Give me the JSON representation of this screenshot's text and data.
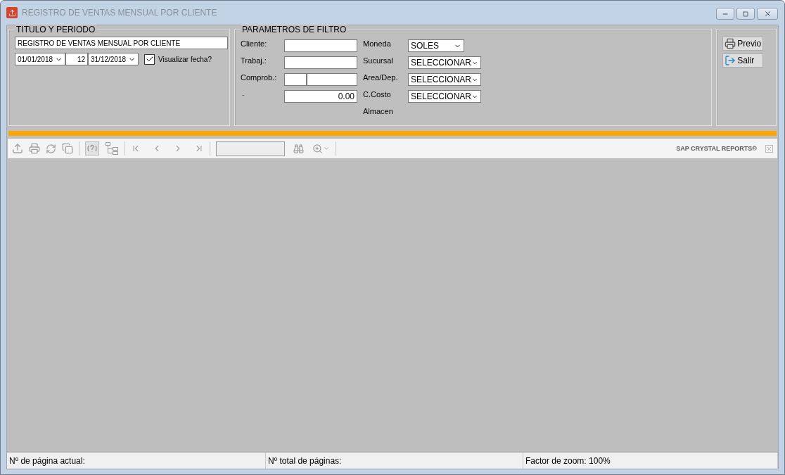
{
  "window": {
    "title": "REGISTRO DE VENTAS MENSUAL POR CLIENTE"
  },
  "titulo_periodo": {
    "legend": "TITULO Y PERIODO",
    "title_value": "REGISTRO DE VENTAS MENSUAL POR CLIENTE",
    "date_from": "01/01/2018",
    "days": "12",
    "date_to": "31/12/2018",
    "show_date": {
      "label": "Visualizar fecha?",
      "checked": true
    }
  },
  "filtros": {
    "legend": "PARAMETROS DE FILTRO",
    "fields": [
      {
        "label": "Cliente:",
        "kind": "text"
      },
      {
        "label": "Trabaj.:",
        "kind": "text"
      },
      {
        "label": "Comprob.:",
        "kind": "split"
      },
      {
        "label": "-",
        "kind": "number",
        "value": "0.00"
      }
    ],
    "combos": [
      {
        "label": "Moneda",
        "value": "SOLES",
        "kind": "short"
      },
      {
        "label": "Sucursal",
        "value": "SELECCIONAR",
        "kind": "wide"
      },
      {
        "label": "Area/Dep.",
        "value": "SELECCIONAR",
        "kind": "wide"
      },
      {
        "label": "C.Costo",
        "value": "SELECCIONAR",
        "kind": "wide"
      },
      {
        "label": "Almacen",
        "kind": "none"
      }
    ]
  },
  "actions": [
    {
      "label": "Previo",
      "kind": "print"
    },
    {
      "label": "Salir",
      "kind": "exit"
    }
  ],
  "viewer": {
    "brand": "SAP CRYSTAL REPORTS®"
  },
  "status_bar": [
    "Nº de página actual:",
    "Nº total de páginas:",
    "Factor de zoom: 100%"
  ]
}
